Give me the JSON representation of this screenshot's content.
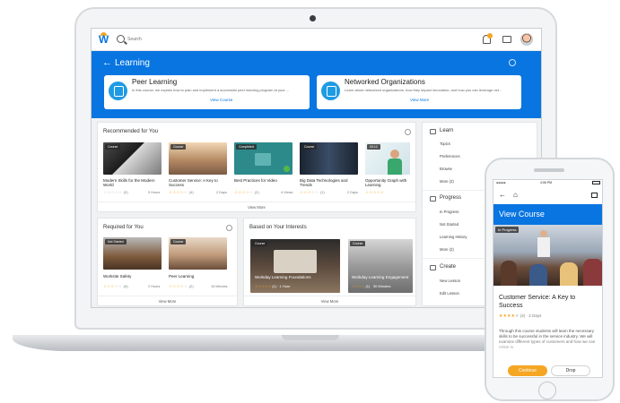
{
  "topbar": {
    "search_placeholder": "Search",
    "logo_letter": "W"
  },
  "hero": {
    "back": "←",
    "title": "Learning"
  },
  "promos": [
    {
      "title": "Peer Learning",
      "desc": "In this course, we explain how to plan and implement a successful peer learning program at your ...",
      "link": "View Course"
    },
    {
      "title": "Networked Organizations",
      "desc": "Learn about networked organizations, how they impact innovation, and how you can leverage net...",
      "link": "View More"
    }
  ],
  "recommended": {
    "title": "Recommended for You",
    "view_more": "View More",
    "cards": [
      {
        "badge": "Course",
        "title": "Modern Skills for the Modern World",
        "stars_on": "",
        "stars_off": "☆☆☆☆☆",
        "count": "(0)",
        "duration": "5 Hours"
      },
      {
        "badge": "Course",
        "title": "Customer Service: A Key to Success",
        "stars_on": "☆☆☆☆",
        "stars_off": "☆",
        "count": "(4)",
        "duration": "2 Days"
      },
      {
        "badge": "Completed",
        "title": "Best Practices for Video",
        "stars_on": "☆☆☆☆",
        "stars_off": "☆",
        "count": "(2)",
        "duration": "4 Views"
      },
      {
        "badge": "Course",
        "title": "Big Data Technologies and Trends",
        "stars_on": "☆☆☆",
        "stars_off": "☆☆",
        "count": "(1)",
        "duration": "2 Days"
      },
      {
        "badge": "00:12",
        "title": "Opportunity Graph with Learning",
        "stars_on": "☆☆☆☆☆",
        "stars_off": "",
        "count": "",
        "duration": ""
      }
    ]
  },
  "required": {
    "title": "Required for You",
    "view_more": "View More",
    "cards": [
      {
        "badge": "Not Started",
        "title": "Worksite Safety",
        "stars_on": "☆☆☆",
        "stars_off": "☆☆",
        "count": "(6)",
        "duration": "2 Hours"
      },
      {
        "badge": "Course",
        "title": "Peer Learning",
        "stars_on": "☆☆☆☆",
        "stars_off": "☆",
        "count": "(2)",
        "duration": "15 Minutes"
      }
    ]
  },
  "interests": {
    "title": "Based on Your Interests",
    "view_more": "View More",
    "cards": [
      {
        "badge": "Course",
        "caption": "Workday Learning Foundations",
        "stars_on": "☆☆☆☆☆",
        "count": "(1) · 1 Hour"
      },
      {
        "badge": "Course",
        "caption": "Workday Learning Engagement",
        "stars_on": "☆☆☆☆",
        "count": "(1) · 30 Minutes"
      }
    ]
  },
  "sidebar": {
    "learn": {
      "title": "Learn",
      "items": [
        "Topics",
        "Preferences",
        "Browse",
        "More (2)"
      ]
    },
    "progress": {
      "title": "Progress",
      "items": [
        "In Progress",
        "Not Started",
        "Learning History",
        "More (2)"
      ]
    },
    "create": {
      "title": "Create",
      "items": [
        "New Lesson",
        "Edit Lesson"
      ]
    }
  },
  "phone": {
    "time": "4:06 PM",
    "title": "View Course",
    "badge": "In Progress",
    "course_title": "Customer Service: A Key to Success",
    "stars_on": "★★★★",
    "stars_off": "★",
    "meta": "(4) · 2 Days",
    "desc": "Through this course students will learn the necessary skills to be successful in the service industry. We will examine different types of customers and how we can relate to",
    "continue": "Continue",
    "drop": "Drop"
  },
  "colors": {
    "brand": "#0875e1",
    "accent": "#f5a623"
  }
}
